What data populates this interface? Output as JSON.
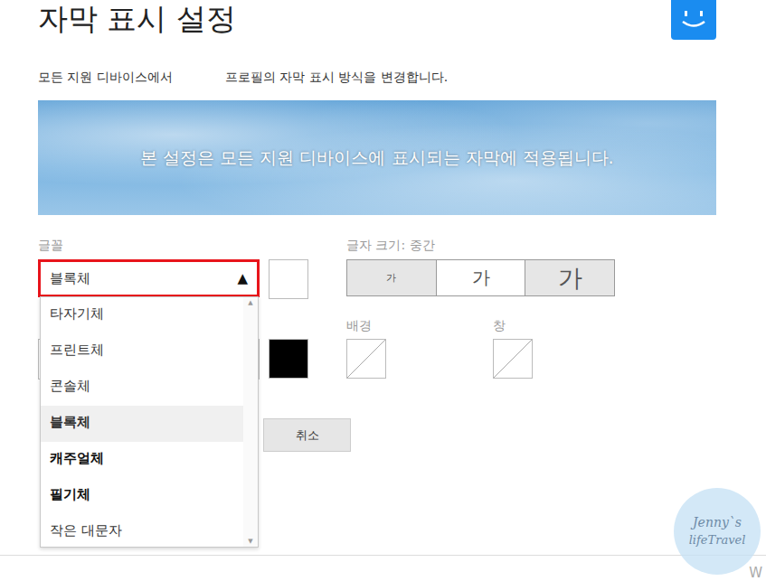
{
  "page": {
    "title": "자막 표시 설정",
    "description_start": "모든 지원 디바이스에서",
    "description_end": "프로필의 자막 표시 방식을 변경합니다."
  },
  "preview": {
    "text": "본 설정은 모든 지원 디바이스에 표시되는 자막에 적용됩니다."
  },
  "font": {
    "label": "글꼴",
    "value": "블록체",
    "arrow": "▲",
    "expanded": true,
    "highlighted": true,
    "scroll_up": "▲",
    "scroll_down": "▼",
    "options": [
      {
        "label": "타자기체",
        "kind": "typewriter",
        "selected": false
      },
      {
        "label": "프린트체",
        "kind": "print",
        "selected": false
      },
      {
        "label": "콘솔체",
        "kind": "console",
        "selected": false
      },
      {
        "label": "블록체",
        "kind": "block",
        "selected": true
      },
      {
        "label": "캐주얼체",
        "kind": "casual",
        "selected": false
      },
      {
        "label": "필기체",
        "kind": "script",
        "selected": false
      },
      {
        "label": "작은 대문자",
        "kind": "smallcaps",
        "selected": false
      }
    ]
  },
  "text_color": {
    "color": "#ffffff"
  },
  "shadow_color": {
    "color": "#000000"
  },
  "size": {
    "label": "글자 크기: 중간",
    "options": [
      {
        "label": "가",
        "kind": "small",
        "selected": false
      },
      {
        "label": "가",
        "kind": "medium",
        "selected": true
      },
      {
        "label": "가",
        "kind": "large",
        "selected": false
      }
    ]
  },
  "background": {
    "label": "배경",
    "empty": true
  },
  "window_option": {
    "label": "창",
    "empty": true
  },
  "buttons": [
    {
      "label": "취소"
    }
  ],
  "watermark": {
    "line1": "Jenny`s",
    "line2": "lifeTravel"
  },
  "footer": {
    "text": "W"
  }
}
